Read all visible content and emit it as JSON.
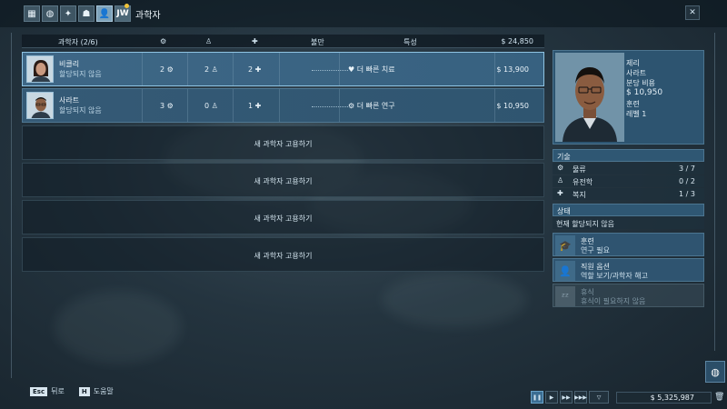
{
  "topbar": {
    "tabs": [
      {
        "icon": "grid-icon",
        "glyph": "▦",
        "active": false
      },
      {
        "icon": "globe-icon",
        "glyph": "◍",
        "active": false
      },
      {
        "icon": "dinosaur-icon",
        "glyph": "✦",
        "active": false
      },
      {
        "icon": "group-icon",
        "glyph": "☗",
        "active": false
      },
      {
        "icon": "person-icon",
        "glyph": "👤",
        "active": true
      },
      {
        "icon": "jw-logo-icon",
        "glyph": "JW",
        "active": false
      }
    ],
    "title": "과학자"
  },
  "table": {
    "headers": {
      "scientists": "과학자 (2/6)",
      "skill1_icon": "gear-icon",
      "skill2_icon": "flask-icon",
      "skill3_icon": "cross-icon",
      "dissatisfaction": "불만",
      "trait": "특성",
      "total": "$ 24,850"
    },
    "rows": [
      {
        "name": "비클리",
        "status": "할당되지 않음",
        "s1": "2",
        "s2": "2",
        "s3": "2",
        "trait": "더 빠른 치료",
        "salary": "$ 13,900",
        "selected": true
      },
      {
        "name": "사라트",
        "status": "할당되지 않음",
        "s1": "3",
        "s2": "0",
        "s3": "1",
        "trait": "더 빠른 연구",
        "salary": "$ 10,950",
        "selected": false
      }
    ],
    "hire_label": "새 과학자 고용하기"
  },
  "profile": {
    "first": "제리",
    "last": "사라트",
    "cost_label": "분당 비용",
    "cost": "$ 10,950",
    "train_label": "훈련",
    "level": "레벨 1"
  },
  "skills": {
    "title": "기술",
    "items": [
      {
        "icon": "gear-icon",
        "name": "물류",
        "value": "3 / 7"
      },
      {
        "icon": "flask-icon",
        "name": "유전학",
        "value": "0 / 2"
      },
      {
        "icon": "cross-icon",
        "name": "복지",
        "value": "1 / 3"
      }
    ]
  },
  "status": {
    "title": "상태",
    "text": "현재 할당되지 않음"
  },
  "actions": [
    {
      "icon": "graduation-cap-icon",
      "t1": "훈련",
      "t2": "연구 필요",
      "disabled": false
    },
    {
      "icon": "staff-fire-icon",
      "t1": "직원 옵션",
      "t2": "역할 보기/과학자 해고",
      "disabled": false
    },
    {
      "icon": "sleep-icon",
      "t1": "휴식",
      "t2": "휴식이 필요하지 않음",
      "disabled": true
    }
  ],
  "bottom": {
    "esc_key": "Esc",
    "esc_label": "뒤로",
    "help_key": "H",
    "help_label": "도움말",
    "money": "$ 5,325,987"
  }
}
